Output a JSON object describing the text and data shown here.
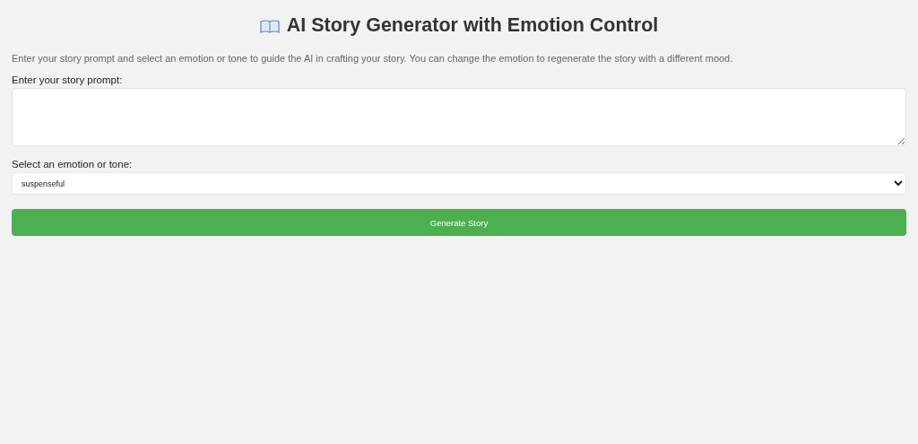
{
  "title": "AI Story Generator with Emotion Control",
  "description": "Enter your story prompt and select an emotion or tone to guide the AI in crafting your story. You can change the emotion to regenerate the story with a different mood.",
  "prompt": {
    "label": "Enter your story prompt:"
  },
  "emotion": {
    "label": "Select an emotion or tone:",
    "value": "suspenseful"
  },
  "button": "Generate Story"
}
